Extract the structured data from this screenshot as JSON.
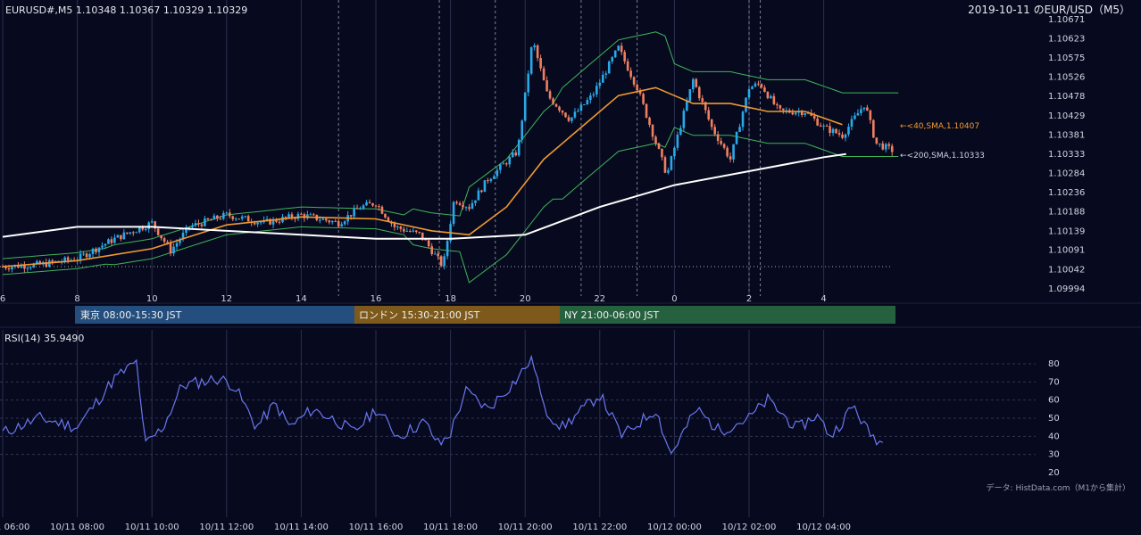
{
  "header": {
    "ohlc": "EURUSD#,M5 1.10348 1.10367 1.10329 1.10329",
    "title": "2019-10-11 のEUR/USD（M5）"
  },
  "sma_labels": {
    "sma40": "←<40,SMA,1.10407",
    "sma200": "←<200,SMA,1.10333"
  },
  "sessions": [
    {
      "label": "東京 08:00-15:30 JST",
      "color": "#244e7d"
    },
    {
      "label": "ロンドン 15:30-21:00 JST",
      "color": "#7d5a1b"
    },
    {
      "label": "NY 21:00-06:00 JST",
      "color": "#26613f"
    }
  ],
  "rsi": {
    "label": "RSI(14) 35.9490",
    "ticks": [
      "80",
      "70",
      "60",
      "50",
      "40",
      "30",
      "20"
    ]
  },
  "source": "データ: HistData.com（M1から集計）",
  "colors": {
    "bull": "#2aa8e8",
    "bear": "#f07f60",
    "sma40": "#f09a30",
    "sma200": "#ffffff",
    "bands": "#3fb45a",
    "rsi": "#6a76f0"
  },
  "chart_data": [
    {
      "type": "candlestick",
      "title": "2019-10-11 のEUR/USD（M5）",
      "y_ticks": [
        "1.10671",
        "1.10623",
        "1.10575",
        "1.10526",
        "1.10478",
        "1.10429",
        "1.10381",
        "1.10333",
        "1.10284",
        "1.10236",
        "1.10188",
        "1.10139",
        "1.10091",
        "1.10042",
        "1.09994"
      ],
      "ylim": [
        1.09994,
        1.10671
      ],
      "x_ticks": [
        "6",
        "8",
        "10",
        "12",
        "14",
        "16",
        "18",
        "20",
        "22",
        "0",
        "2",
        "4"
      ],
      "x_unit": "hour JST",
      "series": [
        {
          "name": "40,SMA",
          "last": 1.10407,
          "points": [
            [
              6,
              1.1005
            ],
            [
              8,
              1.10065
            ],
            [
              10,
              1.10095
            ],
            [
              12,
              1.10155
            ],
            [
              14,
              1.10175
            ],
            [
              16,
              1.1017
            ],
            [
              17.5,
              1.1014
            ],
            [
              18.5,
              1.1013
            ],
            [
              19.5,
              1.102
            ],
            [
              20.5,
              1.1032
            ],
            [
              21.5,
              1.104
            ],
            [
              22.5,
              1.1048
            ],
            [
              23.5,
              1.105
            ],
            [
              24.5,
              1.1046
            ],
            [
              25.5,
              1.1046
            ],
            [
              26.5,
              1.1044
            ],
            [
              27.5,
              1.1044
            ],
            [
              28.5,
              1.10407
            ]
          ]
        },
        {
          "name": "200,SMA",
          "last": 1.10333,
          "points": [
            [
              6,
              1.10125
            ],
            [
              8,
              1.1015
            ],
            [
              10,
              1.1015
            ],
            [
              12,
              1.1014
            ],
            [
              14,
              1.1013
            ],
            [
              16,
              1.1012
            ],
            [
              18,
              1.1012
            ],
            [
              20,
              1.1013
            ],
            [
              22,
              1.102
            ],
            [
              24,
              1.10255
            ],
            [
              26,
              1.1029
            ],
            [
              28,
              1.10325
            ],
            [
              28.6,
              1.10333
            ]
          ]
        }
      ]
    },
    {
      "type": "line",
      "title": "RSI(14) 35.9490",
      "ylim": [
        20,
        80
      ],
      "x_ticks": [
        "10/11 06:00",
        "10/11 08:00",
        "10/11 10:00",
        "10/11 12:00",
        "10/11 14:00",
        "10/11 16:00",
        "10/11 18:00",
        "10/11 20:00",
        "10/11 22:00",
        "10/12 00:00",
        "10/12 02:00",
        "10/12 04:00"
      ],
      "series": [
        {
          "name": "RSI(14)",
          "last": 35.949,
          "points": [
            [
              6,
              42
            ],
            [
              7,
              50
            ],
            [
              8,
              45
            ],
            [
              9,
              72
            ],
            [
              9.6,
              81
            ],
            [
              9.8,
              35
            ],
            [
              10.3,
              45
            ],
            [
              10.8,
              68
            ],
            [
              11.8,
              72
            ],
            [
              12.2,
              68
            ],
            [
              12.8,
              45
            ],
            [
              13.3,
              58
            ],
            [
              13.7,
              45
            ],
            [
              14.3,
              55
            ],
            [
              15,
              48
            ],
            [
              15.4,
              42
            ],
            [
              16,
              55
            ],
            [
              16.6,
              40
            ],
            [
              17.3,
              48
            ],
            [
              17.7,
              35
            ],
            [
              18,
              42
            ],
            [
              18.4,
              65
            ],
            [
              19,
              55
            ],
            [
              19.8,
              72
            ],
            [
              20.2,
              84
            ],
            [
              20.5,
              55
            ],
            [
              21,
              45
            ],
            [
              22,
              63
            ],
            [
              22.6,
              40
            ],
            [
              23.5,
              55
            ],
            [
              23.9,
              30
            ],
            [
              24.6,
              55
            ],
            [
              25.2,
              43
            ],
            [
              26,
              50
            ],
            [
              26.5,
              60
            ],
            [
              27.3,
              44
            ],
            [
              27.8,
              52
            ],
            [
              28.2,
              40
            ],
            [
              28.8,
              57
            ],
            [
              29.2,
              42
            ],
            [
              29.6,
              36
            ]
          ]
        }
      ]
    }
  ]
}
